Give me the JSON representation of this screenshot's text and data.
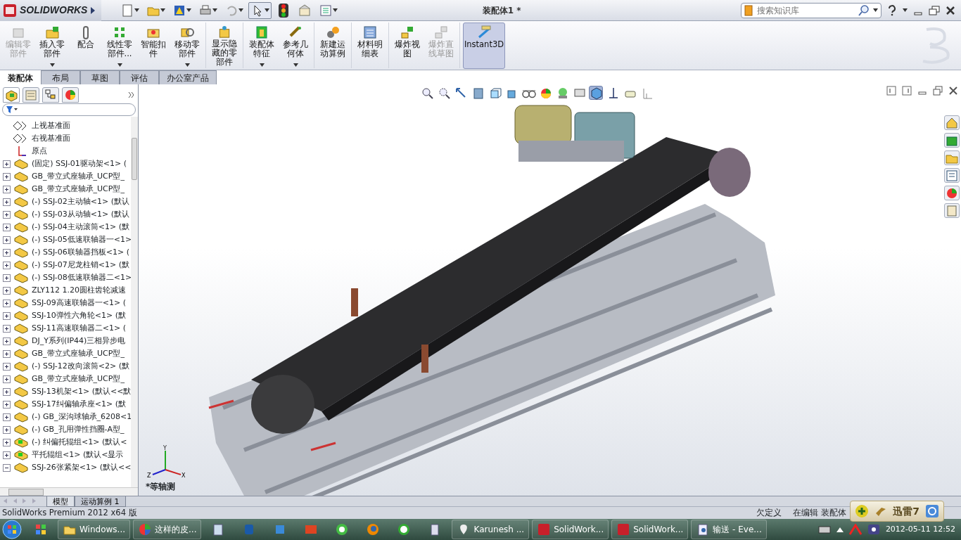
{
  "app": {
    "logo": "SOLIDWORKS"
  },
  "window": {
    "title": "装配体1 *"
  },
  "search": {
    "placeholder": "搜索知识库"
  },
  "command_manager": [
    {
      "label": "编辑零部件",
      "disabled": true,
      "dropdown": false,
      "pressed": false
    },
    {
      "label": "插入零部件",
      "disabled": false,
      "dropdown": true,
      "pressed": false
    },
    {
      "label": "配合",
      "disabled": false,
      "dropdown": false,
      "pressed": false
    },
    {
      "label": "线性零部件...",
      "disabled": false,
      "dropdown": true,
      "pressed": false
    },
    {
      "label": "智能扣件",
      "disabled": false,
      "dropdown": false,
      "pressed": false
    },
    {
      "label": "移动零部件",
      "disabled": false,
      "dropdown": true,
      "pressed": false
    },
    {
      "label": "显示隐藏的零部件",
      "disabled": false,
      "dropdown": false,
      "pressed": false
    },
    {
      "label": "装配体特征",
      "disabled": false,
      "dropdown": true,
      "pressed": false
    },
    {
      "label": "参考几何体",
      "disabled": false,
      "dropdown": true,
      "pressed": false
    },
    {
      "label": "新建运动算例",
      "disabled": false,
      "dropdown": false,
      "pressed": false
    },
    {
      "label": "材料明细表",
      "disabled": false,
      "dropdown": false,
      "pressed": false
    },
    {
      "label": "爆炸视图",
      "disabled": false,
      "dropdown": false,
      "pressed": false
    },
    {
      "label": "爆炸直线草图",
      "disabled": true,
      "dropdown": false,
      "pressed": false
    },
    {
      "label": "Instant3D",
      "disabled": false,
      "dropdown": false,
      "pressed": true
    }
  ],
  "tabs": [
    {
      "label": "装配体",
      "selected": true
    },
    {
      "label": "布局",
      "selected": false
    },
    {
      "label": "草图",
      "selected": false
    },
    {
      "label": "评估",
      "selected": false
    },
    {
      "label": "办公室产品",
      "selected": false
    }
  ],
  "panel_tabs": [
    {
      "selected": true
    },
    {
      "selected": false
    },
    {
      "selected": false
    },
    {
      "selected": false
    }
  ],
  "tree": [
    {
      "label": "上视基准面",
      "kind": "plane"
    },
    {
      "label": "右视基准面",
      "kind": "plane"
    },
    {
      "label": "原点",
      "kind": "origin"
    },
    {
      "label": "(固定) SSJ-01驱动架<1> (",
      "kind": "part",
      "expanded": false
    },
    {
      "label": "GB_带立式座轴承_UCP型_",
      "kind": "part",
      "expanded": false
    },
    {
      "label": "GB_带立式座轴承_UCP型_",
      "kind": "part",
      "expanded": false
    },
    {
      "label": "(-) SSJ-02主动轴<1> (默认",
      "kind": "part",
      "expanded": false
    },
    {
      "label": "(-) SSJ-03从动轴<1> (默认",
      "kind": "part",
      "expanded": false
    },
    {
      "label": "(-) SSJ-04主动滚筒<1> (默",
      "kind": "part",
      "expanded": false
    },
    {
      "label": "(-) SSJ-05低速联轴器一<1>",
      "kind": "part",
      "expanded": false
    },
    {
      "label": "(-) SSJ-06联轴器挡板<1> (",
      "kind": "part",
      "expanded": false
    },
    {
      "label": "(-) SSJ-07尼龙柱销<1> (默",
      "kind": "part",
      "expanded": false
    },
    {
      "label": "(-) SSJ-08低速联轴器二<1>",
      "kind": "part",
      "expanded": false
    },
    {
      "label": "ZLY112 1.20圆柱齿轮减速",
      "kind": "part",
      "expanded": false
    },
    {
      "label": "SSJ-09高速联轴器一<1> (",
      "kind": "part",
      "expanded": false
    },
    {
      "label": "SSJ-10弹性六角轮<1> (默",
      "kind": "part",
      "expanded": false
    },
    {
      "label": "SSJ-11高速联轴器二<1> (",
      "kind": "part",
      "expanded": false
    },
    {
      "label": "DJ_Y系列(IP44)三相异步电",
      "kind": "part",
      "expanded": false
    },
    {
      "label": "GB_带立式座轴承_UCP型_",
      "kind": "part",
      "expanded": false
    },
    {
      "label": "(-) SSJ-12改向滚筒<2> (默",
      "kind": "part",
      "expanded": false
    },
    {
      "label": "GB_带立式座轴承_UCP型_",
      "kind": "part",
      "expanded": false
    },
    {
      "label": "SSJ-13机架<1> (默认<<默",
      "kind": "part",
      "expanded": false
    },
    {
      "label": "SSJ-17纠偏轴承座<1> (默",
      "kind": "part",
      "expanded": false
    },
    {
      "label": "(-) GB_深沟球轴承_6208<1",
      "kind": "part",
      "expanded": false
    },
    {
      "label": "(-) GB_孔用弹性挡圈-A型_",
      "kind": "part",
      "expanded": false
    },
    {
      "label": "(-) 纠偏托辊组<1> (默认<",
      "kind": "subassembly",
      "expanded": false
    },
    {
      "label": "平托辊组<1> (默认<显示",
      "kind": "subassembly",
      "expanded": false
    },
    {
      "label": "SSJ-26张紧架<1> (默认<<",
      "kind": "part",
      "expanded": true
    }
  ],
  "triad": {
    "x": "X",
    "y": "Y",
    "z": "Z"
  },
  "view": {
    "orientation": "*等轴测"
  },
  "bottom_tabs": [
    {
      "label": "模型",
      "selected": true
    },
    {
      "label": "运动算例 1",
      "selected": false
    }
  ],
  "status_bar": {
    "product": "SolidWorks Premium 2012 x64 版",
    "state": "欠定义",
    "mode": "在编辑 装配体"
  },
  "taskbar": [
    {
      "kind": "tiles"
    },
    {
      "kind": "folder",
      "label": "Windows..."
    },
    {
      "kind": "pinwheel",
      "label": "这样的皮..."
    },
    {
      "kind": "notepad"
    },
    {
      "kind": "penguin"
    },
    {
      "kind": "cube"
    },
    {
      "kind": "it"
    },
    {
      "kind": "browser"
    },
    {
      "kind": "firefox"
    },
    {
      "kind": "sogou"
    },
    {
      "kind": "calculator"
    },
    {
      "kind": "alien",
      "label": "Karunesh ..."
    },
    {
      "kind": "sw",
      "label": "SolidWork..."
    },
    {
      "kind": "sw",
      "label": "SolidWork..."
    },
    {
      "kind": "doc",
      "label": "输送 - Eve..."
    }
  ],
  "tray": {
    "clock": "2012-05-11 12:52"
  },
  "download_popup": {
    "title": "迅雷7"
  }
}
